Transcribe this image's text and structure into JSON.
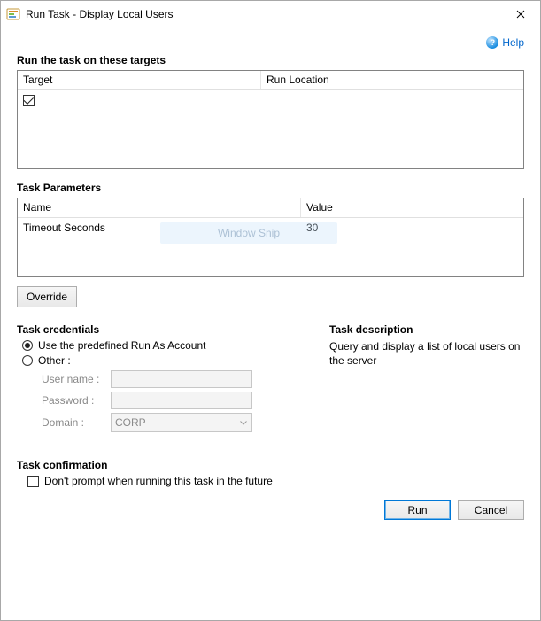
{
  "window": {
    "title": "Run Task - Display Local Users"
  },
  "help": {
    "label": "Help"
  },
  "targets": {
    "header": "Run the task on these targets",
    "columns": {
      "target": "Target",
      "run_location": "Run Location"
    },
    "col_widths": {
      "target": 275
    },
    "rows": [
      {
        "checked": true,
        "target": "",
        "run_location": ""
      }
    ]
  },
  "parameters": {
    "header": "Task Parameters",
    "columns": {
      "name": "Name",
      "value": "Value"
    },
    "col_widths": {
      "name": 320
    },
    "rows": [
      {
        "name": "Timeout Seconds",
        "value": "30"
      }
    ],
    "override_label": "Override"
  },
  "credentials": {
    "header": "Task credentials",
    "option_predefined": "Use the predefined Run As Account",
    "option_other": "Other :",
    "selected": "predefined",
    "fields": {
      "username_label": "User name :",
      "username_value": "",
      "password_label": "Password :",
      "password_value": "",
      "domain_label": "Domain :",
      "domain_value": "CORP"
    }
  },
  "description": {
    "header": "Task description",
    "text": "Query and display a list of local users on the server"
  },
  "confirmation": {
    "header": "Task confirmation",
    "checkbox_label": "Don't prompt when running this task in the future",
    "checked": false
  },
  "buttons": {
    "run": "Run",
    "cancel": "Cancel"
  },
  "overlay": {
    "window_snip": "Window Snip"
  }
}
